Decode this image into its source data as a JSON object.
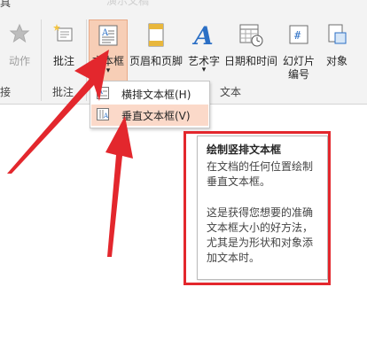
{
  "title_bar": {
    "left_text": "具",
    "faded_text": "演示文稿"
  },
  "ribbon": {
    "buttons": {
      "action": "动作",
      "comment": "批注",
      "textbox": "文本框",
      "header_footer": "页眉和页脚",
      "wordart": "艺术字",
      "datetime": "日期和时间",
      "slide_number_line1": "幻灯片",
      "slide_number_line2": "编号",
      "object": "对象"
    },
    "group_labels": {
      "links": "接",
      "comments": "批注",
      "text": "文本"
    }
  },
  "dropdown": {
    "items": [
      {
        "label": "横排文本框(H)"
      },
      {
        "label": "垂直文本框(V)"
      }
    ]
  },
  "tooltip": {
    "title": "绘制竖排文本框",
    "para1": "在文档的任何位置绘制\n垂直文本框。",
    "para2": "这是获得您想要的准确\n文本框大小的好方法，\n尤其是为形状和对象添\n加文本时。"
  },
  "colors": {
    "selected_fill": "#f7ceb6",
    "hover_fill": "#fbd9c9",
    "annotation_red": "#e3272d",
    "accent_blue": "#2b6fc5"
  }
}
